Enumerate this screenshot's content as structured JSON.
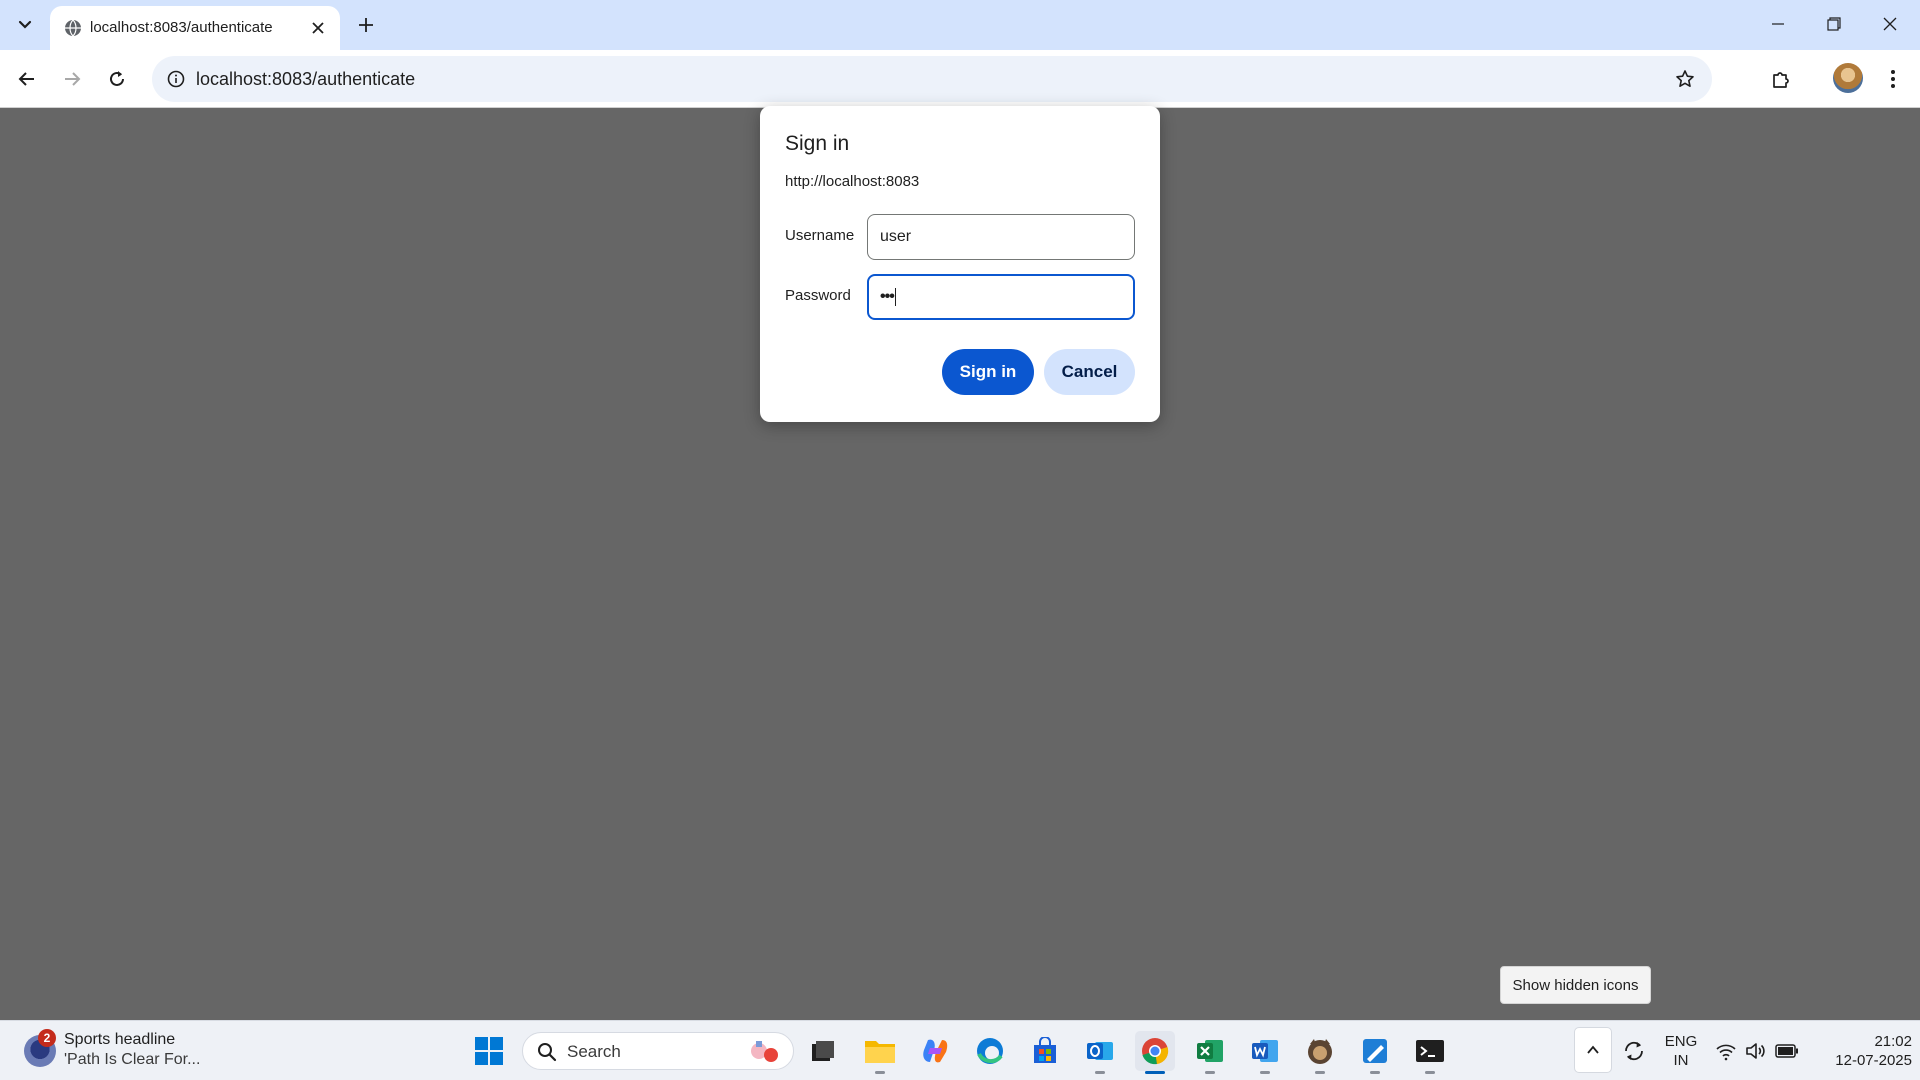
{
  "browser": {
    "tab": {
      "title": "localhost:8083/authenticate"
    },
    "address_bar": {
      "url": "localhost:8083/authenticate"
    }
  },
  "dialog": {
    "title": "Sign in",
    "origin": "http://localhost:8083",
    "username_label": "Username",
    "username_value": "user",
    "password_label": "Password",
    "password_masked": "•••",
    "sign_in_label": "Sign in",
    "cancel_label": "Cancel"
  },
  "tooltip": {
    "text": "Show hidden icons"
  },
  "taskbar": {
    "widget": {
      "badge": "2",
      "title": "Sports headline",
      "subtitle": "'Path Is Clear For..."
    },
    "search_label": "Search",
    "language": {
      "line1": "ENG",
      "line2": "IN"
    },
    "clock": {
      "time": "21:02",
      "date": "12-07-2025"
    }
  },
  "colors": {
    "accent": "#0b57d0",
    "tabstrip": "#d3e3fd",
    "page_overlay": "#666666"
  }
}
